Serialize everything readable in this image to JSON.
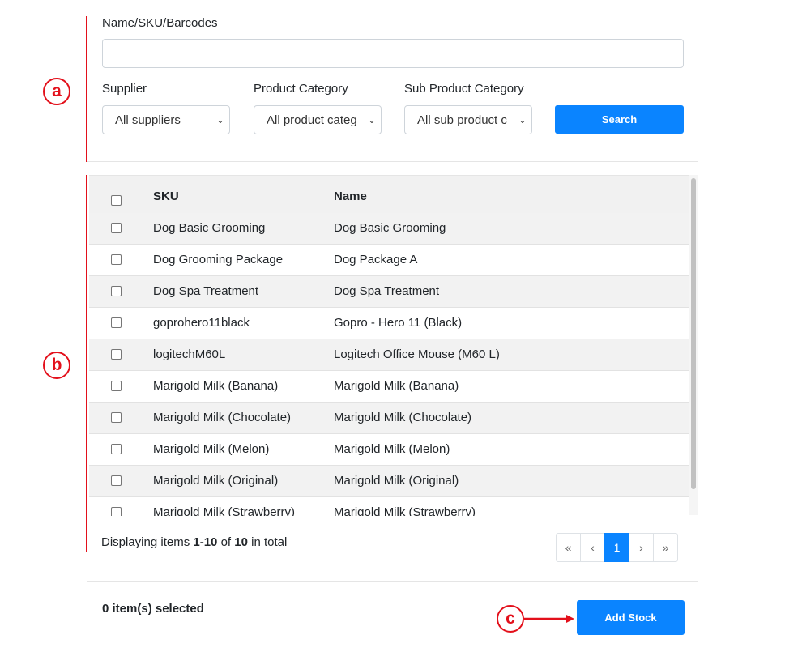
{
  "annotations": {
    "a": "a",
    "b": "b",
    "c": "c"
  },
  "filters": {
    "name_label": "Name/SKU/Barcodes",
    "name_value": "",
    "supplier_label": "Supplier",
    "supplier_value": "All suppliers",
    "category_label": "Product Category",
    "category_value": "All product categ",
    "subcategory_label": "Sub Product Category",
    "subcategory_value": "All sub product c",
    "search_button": "Search"
  },
  "table": {
    "headers": {
      "sku": "SKU",
      "name": "Name"
    },
    "rows": [
      {
        "sku": "Dog Basic Grooming",
        "name": "Dog Basic Grooming"
      },
      {
        "sku": "Dog Grooming Package",
        "name": "Dog Package A"
      },
      {
        "sku": "Dog Spa Treatment",
        "name": "Dog Spa Treatment"
      },
      {
        "sku": "goprohero11black",
        "name": "Gopro - Hero 11 (Black)"
      },
      {
        "sku": "logitechM60L",
        "name": "Logitech Office Mouse (M60 L)"
      },
      {
        "sku": "Marigold Milk (Banana)",
        "name": "Marigold Milk (Banana)"
      },
      {
        "sku": "Marigold Milk (Chocolate)",
        "name": "Marigold Milk (Chocolate)"
      },
      {
        "sku": "Marigold Milk (Melon)",
        "name": "Marigold Milk (Melon)"
      },
      {
        "sku": "Marigold Milk (Original)",
        "name": "Marigold Milk (Original)"
      },
      {
        "sku": "Marigold Milk (Strawberry)",
        "name": "Marigold Milk (Strawberry)"
      }
    ]
  },
  "footer": {
    "display_prefix": "Displaying items ",
    "display_range": "1-10",
    "display_of": " of ",
    "display_total": "10",
    "display_suffix": " in total",
    "pagination": [
      "«",
      "‹",
      "1",
      "›",
      "»"
    ],
    "selected_text": "0 item(s) selected",
    "add_stock_button": "Add Stock"
  },
  "colors": {
    "accent": "#0a84ff",
    "annotation_red": "#e3101b"
  }
}
